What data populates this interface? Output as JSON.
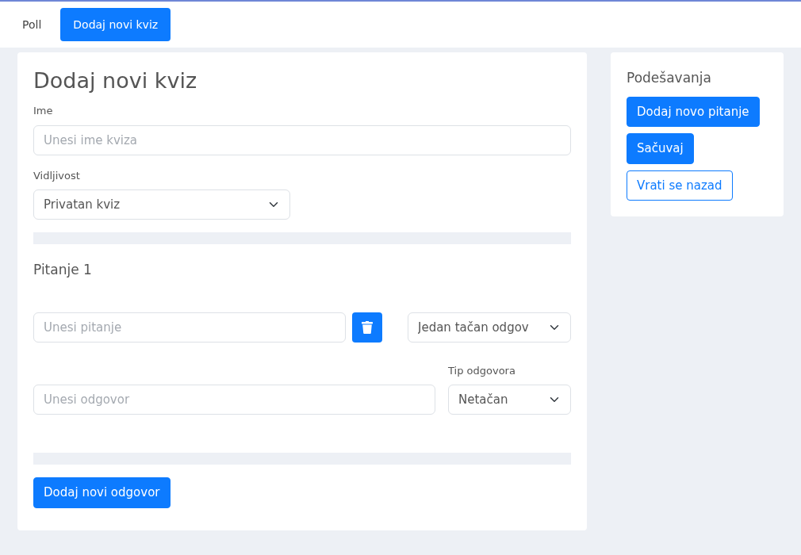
{
  "nav": [
    {
      "label": "Poll",
      "selected": false
    },
    {
      "label": "Dodaj novi kviz",
      "selected": true
    }
  ],
  "form": {
    "title": "Dodaj novi kviz",
    "name_label": "Ime",
    "name_placeholder": "Unesi ime kviza",
    "visibility_label": "Vidljivost",
    "visibility_value": "Privatan kviz",
    "questions": [
      {
        "title": "Pitanje 1",
        "placeholder": "Unesi pitanje",
        "type_value": "Jedan tačan odgov",
        "answers": [
          {
            "placeholder": "Unesi odgovor",
            "type_label": "Tip odgovora",
            "type_value": "Netačan"
          }
        ]
      }
    ],
    "add_answer_button": "Dodaj novi odgovor"
  },
  "settings": {
    "title": "Podešavanja",
    "buttons": [
      {
        "label": "Dodaj novo pitanje",
        "kind": "primary"
      },
      {
        "label": "Sačuvaj",
        "kind": "primary"
      },
      {
        "label": "Vrati se nazad",
        "kind": "outline"
      }
    ]
  }
}
